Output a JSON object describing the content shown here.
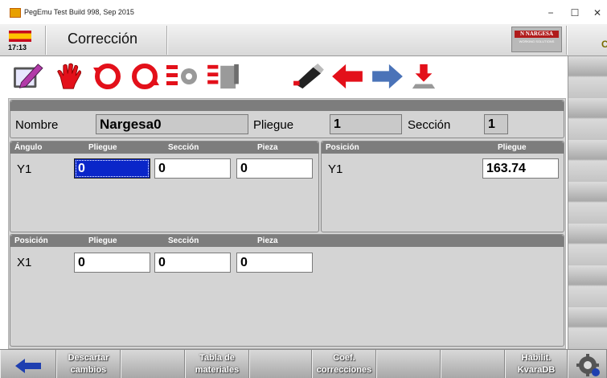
{
  "window": {
    "title": "PegEmu Test Build 998, Sep 2015",
    "minimize_glyph": "−",
    "maximize_glyph": "☐",
    "close_glyph": "✕"
  },
  "header": {
    "time": "17:13",
    "page_title": "Corrección",
    "logo_name": "N NARGESA",
    "logo_sub": "WORKING SOLUTIONS",
    "flag": "spain-flag",
    "cut_letter": "C"
  },
  "toolbar": {
    "icons": [
      "edit-icon",
      "hand-stop-icon",
      "rotate-left-icon",
      "rotate-right-icon",
      "settings-grid-icon",
      "checklist-icon",
      "usb-drive-icon",
      "arrow-left-icon",
      "arrow-right-icon",
      "download-icon"
    ]
  },
  "info": {
    "nombre_label": "Nombre",
    "nombre_value": "Nargesa0",
    "pliegue_label": "Pliegue",
    "pliegue_value": "1",
    "seccion_label": "Sección",
    "seccion_value": "1"
  },
  "angle": {
    "headers": [
      "Ángulo",
      "Pliegue",
      "Sección",
      "Pieza"
    ],
    "row_label": "Y1",
    "values": [
      "0",
      "0",
      "0"
    ]
  },
  "position_y": {
    "headers": [
      "Posición",
      "Pliegue"
    ],
    "row_label": "Y1",
    "value": "163.74"
  },
  "position_x": {
    "headers": [
      "Posición",
      "Pliegue",
      "Sección",
      "Pieza"
    ],
    "row_label": "X1",
    "values": [
      "0",
      "0",
      "0"
    ]
  },
  "bottom": {
    "back_icon": "arrow-left-blue-icon",
    "descartar": [
      "Descartar",
      "cambios"
    ],
    "tabla": [
      "Tabla de",
      "materiales"
    ],
    "coef": [
      "Coef.",
      "correcciones"
    ],
    "habilit": [
      "Habilit.",
      "KvaraDB"
    ],
    "settings_icon": "gear-icon"
  },
  "colors": {
    "selected_field": "#0a26c9",
    "section_header": "#7d7d7d",
    "panel": "#d4d4d4",
    "arrow_red": "#e01010",
    "arrow_blue": "#4a73b8"
  }
}
